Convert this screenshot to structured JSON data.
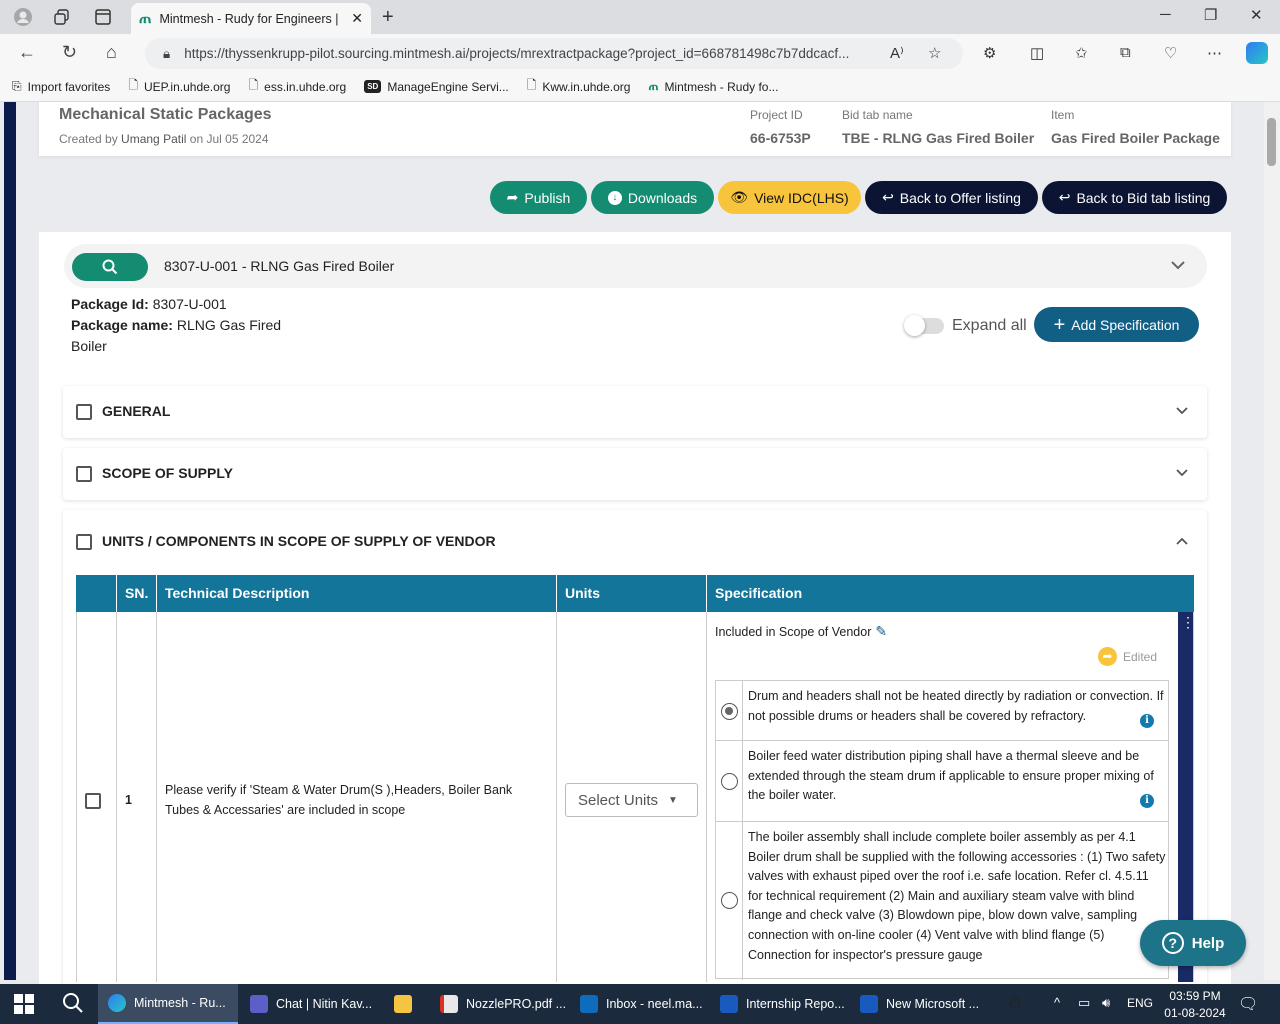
{
  "browser": {
    "tab_title": "Mintmesh - Rudy for Engineers |",
    "url": "https://thyssenkrupp-pilot.sourcing.mintmesh.ai/projects/mrextractpackage?project_id=668781498c7b7ddcacf...",
    "favorites": [
      "Import favorites",
      "UEP.in.uhde.org",
      "ess.in.uhde.org",
      "ManageEngine Servi...",
      "Kww.in.uhde.org",
      "Mintmesh - Rudy fo..."
    ]
  },
  "header": {
    "title": "Mechanical Static Packages",
    "created_prefix": "Created by",
    "created_by": "Umang Patil",
    "created_on_prefix": "on",
    "created_date": "Jul 05 2024",
    "project_id_label": "Project ID",
    "project_id": "66-6753P",
    "bid_tab_label": "Bid tab name",
    "bid_tab": "TBE - RLNG Gas Fired Boiler",
    "item_label": "Item",
    "item": "Gas Fired Boiler Package"
  },
  "actions": {
    "publish": "Publish",
    "downloads": "Downloads",
    "view_idc": "View IDC(LHS)",
    "back_offer": "Back to Offer listing",
    "back_bid": "Back to Bid tab listing"
  },
  "package": {
    "selected": "8307-U-001 - RLNG Gas Fired Boiler",
    "id_label": "Package Id:",
    "id": "8307-U-001",
    "name_label": "Package name:",
    "name": "RLNG Gas Fired Boiler",
    "expand_all": "Expand all",
    "add_spec": "Add Specification"
  },
  "sections": [
    "GENERAL",
    "SCOPE OF SUPPLY",
    "UNITS / COMPONENTS IN SCOPE OF SUPPLY OF VENDOR"
  ],
  "table": {
    "headers": [
      "SN.",
      "Technical Description",
      "Units",
      "Specification"
    ],
    "row": {
      "sn": "1",
      "description": "Please verify if 'Steam & Water Drum(S ),Headers, Boiler Bank Tubes & Accessaries' are included in scope",
      "units_placeholder": "Select Units",
      "spec_title": "Included in Scope of Vendor",
      "edited": "Edited",
      "options": [
        "Drum and headers shall not be heated directly by radiation or convection. If not possible drums or headers shall be covered by refractory.",
        "Boiler feed water distribution piping shall have a thermal sleeve and be extended through the steam drum if applicable to ensure proper mixing of the boiler water.",
        "The boiler assembly shall include complete boiler assembly as per 4.1 Boiler drum shall be supplied with the following accessories : (1) Two safety valves with exhaust piped over the roof i.e. safe location. Refer cl. 4.5.11 for technical requirement (2) Main and auxiliary steam valve with blind flange and check valve (3) Blowdown pipe, blow down valve, sampling connection with on-line cooler (4) Vent valve with blind flange (5) Connection for inspector's pressure gauge"
      ],
      "selected_option": 0
    }
  },
  "help": "Help",
  "taskbar": {
    "apps": [
      "Mintmesh - Ru...",
      "Chat | Nitin Kav...",
      "",
      "NozzlePRO.pdf ...",
      "Inbox - neel.ma...",
      "Internship Repo...",
      "New Microsoft ..."
    ],
    "lang": "ENG",
    "time": "03:59 PM",
    "date": "01-08-2024"
  }
}
